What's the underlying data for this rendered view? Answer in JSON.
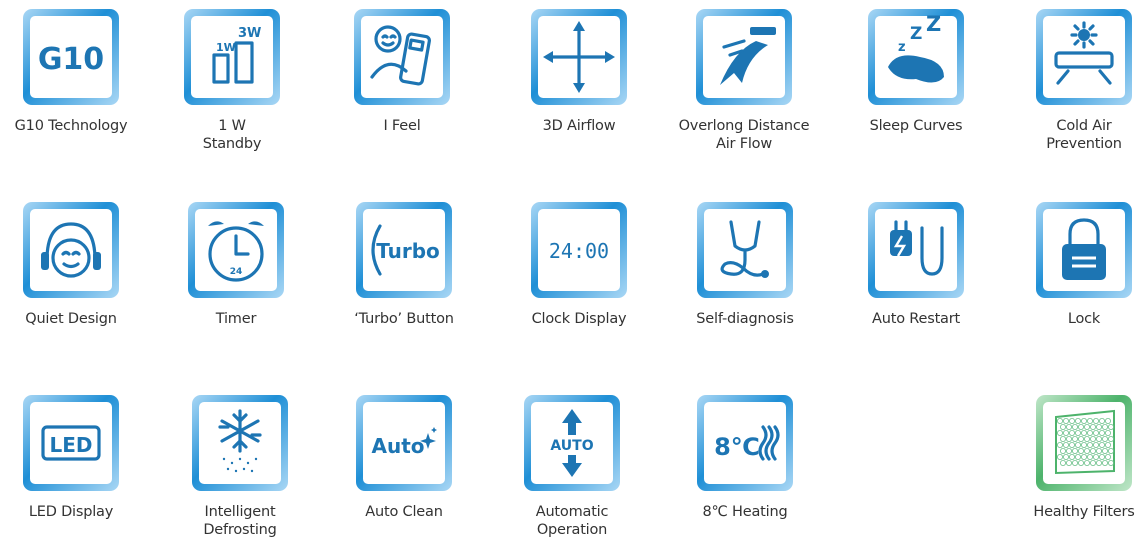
{
  "colors": {
    "blue_frame": "#1f8fd6",
    "blue_icon": "#1d75b3",
    "green_frame": "#4db36b",
    "label_text": "#333333"
  },
  "features": [
    {
      "id": "g10",
      "icon": "g10-icon",
      "label": [
        "G10 Technology"
      ],
      "frame": "blue"
    },
    {
      "id": "standby",
      "icon": "standby-bars-icon",
      "label": [
        "1 W",
        "Standby"
      ],
      "frame": "blue"
    },
    {
      "id": "ifeel",
      "icon": "remote-control-icon",
      "label": [
        "I Feel"
      ],
      "frame": "blue"
    },
    {
      "id": "airflow3d",
      "icon": "four-arrows-icon",
      "label": [
        "3D Airflow"
      ],
      "frame": "blue"
    },
    {
      "id": "overlong",
      "icon": "long-airflow-icon",
      "label": [
        "Overlong Distance",
        "Air Flow"
      ],
      "frame": "blue"
    },
    {
      "id": "sleep",
      "icon": "sleep-pillow-icon",
      "label": [
        "Sleep Curves"
      ],
      "frame": "blue"
    },
    {
      "id": "coldair",
      "icon": "cold-air-prevention-icon",
      "label": [
        "Cold Air",
        "Prevention"
      ],
      "frame": "blue"
    },
    {
      "id": "quiet",
      "icon": "headphones-face-icon",
      "label": [
        "Quiet Design"
      ],
      "frame": "blue"
    },
    {
      "id": "timer",
      "icon": "alarm-clock-icon",
      "label": [
        "Timer"
      ],
      "frame": "blue",
      "icon_text": "24"
    },
    {
      "id": "turbo",
      "icon": "turbo-icon",
      "label": [
        "‘Turbo’ Button"
      ],
      "frame": "blue",
      "icon_text": "Turbo"
    },
    {
      "id": "clock",
      "icon": "digital-clock-icon",
      "label": [
        "Clock Display"
      ],
      "frame": "blue",
      "icon_text": "24:00"
    },
    {
      "id": "diagnosis",
      "icon": "stethoscope-icon",
      "label": [
        "Self-diagnosis"
      ],
      "frame": "blue"
    },
    {
      "id": "restart",
      "icon": "power-plug-icon",
      "label": [
        "Auto Restart"
      ],
      "frame": "blue"
    },
    {
      "id": "lock",
      "icon": "lock-icon",
      "label": [
        "Lock"
      ],
      "frame": "blue"
    },
    {
      "id": "led",
      "icon": "led-icon",
      "label": [
        "LED Display"
      ],
      "frame": "blue",
      "icon_text": "LED"
    },
    {
      "id": "defrost",
      "icon": "snowflake-defrost-icon",
      "label": [
        "Intelligent",
        "Defrosting"
      ],
      "frame": "blue"
    },
    {
      "id": "autoclean",
      "icon": "auto-clean-sparkle-icon",
      "label": [
        "Auto Clean"
      ],
      "frame": "blue",
      "icon_text": "Auto"
    },
    {
      "id": "autoop",
      "icon": "auto-arrows-icon",
      "label": [
        "Automatic",
        "Operation"
      ],
      "frame": "blue",
      "icon_text": "AUTO"
    },
    {
      "id": "heating",
      "icon": "heat-waves-icon",
      "label": [
        "8℃ Heating"
      ],
      "frame": "blue",
      "icon_text": "8℃"
    },
    {
      "id": "filters",
      "icon": "honeycomb-filter-icon",
      "label": [
        "Healthy Filters"
      ],
      "frame": "green"
    }
  ]
}
